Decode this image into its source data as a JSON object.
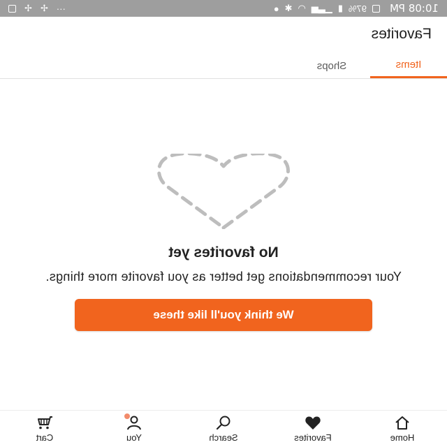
{
  "status_bar": {
    "time": "10:08 PM",
    "battery": "97%",
    "icons": [
      "gallery-icon",
      "battery-icon",
      "signal-icon",
      "wifi-icon",
      "bluetooth-icon",
      "location-icon"
    ],
    "right_icons": [
      "more-icon",
      "fan-icon",
      "fan-icon",
      "image-icon"
    ]
  },
  "header": {
    "title": "Favorites"
  },
  "tabs": [
    {
      "label": "Items",
      "active": true
    },
    {
      "label": "Shops",
      "active": false
    }
  ],
  "empty_state": {
    "title": "No favorites yet",
    "description": "Your recommendations get better as you favorite more things.",
    "cta_label": "We think you'll like these"
  },
  "bottom_nav": [
    {
      "label": "Home",
      "icon": "home-icon"
    },
    {
      "label": "Favorites",
      "icon": "heart-icon"
    },
    {
      "label": "Search",
      "icon": "search-icon"
    },
    {
      "label": "You",
      "icon": "user-icon"
    },
    {
      "label": "Cart",
      "icon": "cart-icon"
    }
  ],
  "colors": {
    "accent": "#f1641e",
    "status_bar": "#9e9e9e",
    "notification_dot": "#f28b6b"
  }
}
